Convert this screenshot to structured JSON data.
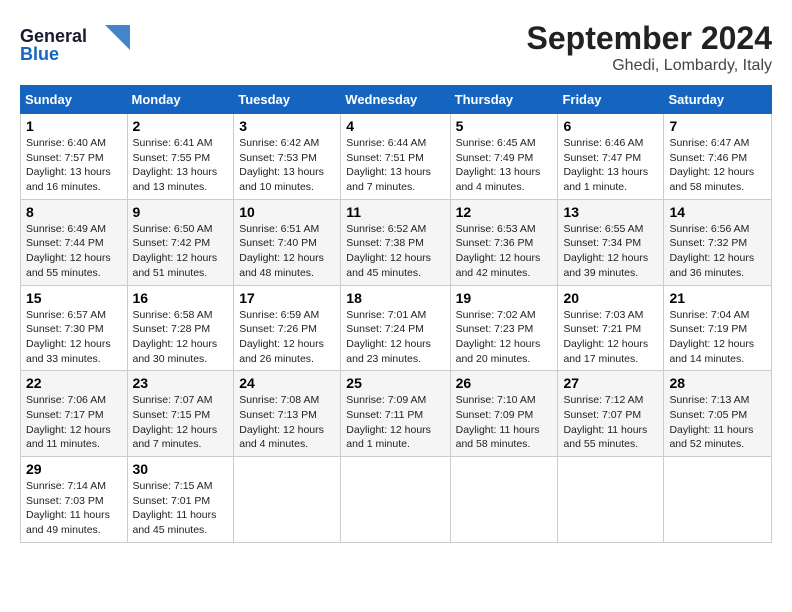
{
  "logo": {
    "line1": "General",
    "line2": "Blue"
  },
  "title": "September 2024",
  "subtitle": "Ghedi, Lombardy, Italy",
  "days_of_week": [
    "Sunday",
    "Monday",
    "Tuesday",
    "Wednesday",
    "Thursday",
    "Friday",
    "Saturday"
  ],
  "weeks": [
    [
      {
        "day": 1,
        "sunrise": "6:40 AM",
        "sunset": "7:57 PM",
        "daylight": "13 hours and 16 minutes."
      },
      {
        "day": 2,
        "sunrise": "6:41 AM",
        "sunset": "7:55 PM",
        "daylight": "13 hours and 13 minutes."
      },
      {
        "day": 3,
        "sunrise": "6:42 AM",
        "sunset": "7:53 PM",
        "daylight": "13 hours and 10 minutes."
      },
      {
        "day": 4,
        "sunrise": "6:44 AM",
        "sunset": "7:51 PM",
        "daylight": "13 hours and 7 minutes."
      },
      {
        "day": 5,
        "sunrise": "6:45 AM",
        "sunset": "7:49 PM",
        "daylight": "13 hours and 4 minutes."
      },
      {
        "day": 6,
        "sunrise": "6:46 AM",
        "sunset": "7:47 PM",
        "daylight": "13 hours and 1 minute."
      },
      {
        "day": 7,
        "sunrise": "6:47 AM",
        "sunset": "7:46 PM",
        "daylight": "12 hours and 58 minutes."
      }
    ],
    [
      {
        "day": 8,
        "sunrise": "6:49 AM",
        "sunset": "7:44 PM",
        "daylight": "12 hours and 55 minutes."
      },
      {
        "day": 9,
        "sunrise": "6:50 AM",
        "sunset": "7:42 PM",
        "daylight": "12 hours and 51 minutes."
      },
      {
        "day": 10,
        "sunrise": "6:51 AM",
        "sunset": "7:40 PM",
        "daylight": "12 hours and 48 minutes."
      },
      {
        "day": 11,
        "sunrise": "6:52 AM",
        "sunset": "7:38 PM",
        "daylight": "12 hours and 45 minutes."
      },
      {
        "day": 12,
        "sunrise": "6:53 AM",
        "sunset": "7:36 PM",
        "daylight": "12 hours and 42 minutes."
      },
      {
        "day": 13,
        "sunrise": "6:55 AM",
        "sunset": "7:34 PM",
        "daylight": "12 hours and 39 minutes."
      },
      {
        "day": 14,
        "sunrise": "6:56 AM",
        "sunset": "7:32 PM",
        "daylight": "12 hours and 36 minutes."
      }
    ],
    [
      {
        "day": 15,
        "sunrise": "6:57 AM",
        "sunset": "7:30 PM",
        "daylight": "12 hours and 33 minutes."
      },
      {
        "day": 16,
        "sunrise": "6:58 AM",
        "sunset": "7:28 PM",
        "daylight": "12 hours and 30 minutes."
      },
      {
        "day": 17,
        "sunrise": "6:59 AM",
        "sunset": "7:26 PM",
        "daylight": "12 hours and 26 minutes."
      },
      {
        "day": 18,
        "sunrise": "7:01 AM",
        "sunset": "7:24 PM",
        "daylight": "12 hours and 23 minutes."
      },
      {
        "day": 19,
        "sunrise": "7:02 AM",
        "sunset": "7:23 PM",
        "daylight": "12 hours and 20 minutes."
      },
      {
        "day": 20,
        "sunrise": "7:03 AM",
        "sunset": "7:21 PM",
        "daylight": "12 hours and 17 minutes."
      },
      {
        "day": 21,
        "sunrise": "7:04 AM",
        "sunset": "7:19 PM",
        "daylight": "12 hours and 14 minutes."
      }
    ],
    [
      {
        "day": 22,
        "sunrise": "7:06 AM",
        "sunset": "7:17 PM",
        "daylight": "12 hours and 11 minutes."
      },
      {
        "day": 23,
        "sunrise": "7:07 AM",
        "sunset": "7:15 PM",
        "daylight": "12 hours and 7 minutes."
      },
      {
        "day": 24,
        "sunrise": "7:08 AM",
        "sunset": "7:13 PM",
        "daylight": "12 hours and 4 minutes."
      },
      {
        "day": 25,
        "sunrise": "7:09 AM",
        "sunset": "7:11 PM",
        "daylight": "12 hours and 1 minute."
      },
      {
        "day": 26,
        "sunrise": "7:10 AM",
        "sunset": "7:09 PM",
        "daylight": "11 hours and 58 minutes."
      },
      {
        "day": 27,
        "sunrise": "7:12 AM",
        "sunset": "7:07 PM",
        "daylight": "11 hours and 55 minutes."
      },
      {
        "day": 28,
        "sunrise": "7:13 AM",
        "sunset": "7:05 PM",
        "daylight": "11 hours and 52 minutes."
      }
    ],
    [
      {
        "day": 29,
        "sunrise": "7:14 AM",
        "sunset": "7:03 PM",
        "daylight": "11 hours and 49 minutes."
      },
      {
        "day": 30,
        "sunrise": "7:15 AM",
        "sunset": "7:01 PM",
        "daylight": "11 hours and 45 minutes."
      },
      null,
      null,
      null,
      null,
      null
    ]
  ]
}
